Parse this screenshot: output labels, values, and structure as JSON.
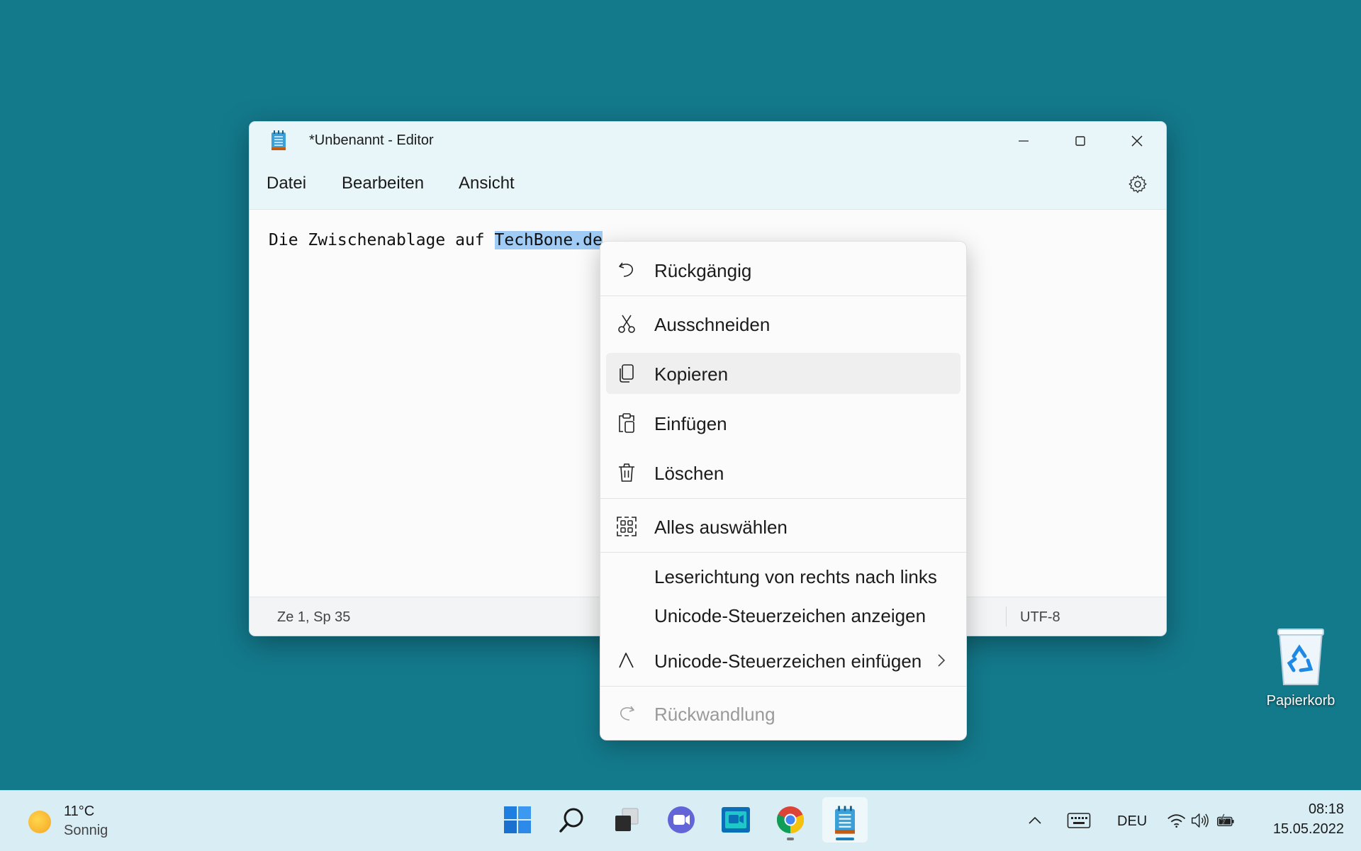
{
  "window": {
    "title": "*Unbenannt - Editor",
    "menu": [
      "Datei",
      "Bearbeiten",
      "Ansicht"
    ],
    "text_before": "Die Zwischenablage auf ",
    "text_selected": "TechBone.de",
    "status": {
      "position": "Ze 1, Sp 35",
      "encoding": "UTF-8"
    }
  },
  "context_menu": {
    "items": [
      {
        "label": "Rückgängig",
        "icon": "undo-icon"
      },
      {
        "label": "Ausschneiden",
        "icon": "scissors-icon"
      },
      {
        "label": "Kopieren",
        "icon": "copy-icon",
        "hovered": true
      },
      {
        "label": "Einfügen",
        "icon": "paste-icon"
      },
      {
        "label": "Löschen",
        "icon": "trash-icon"
      },
      {
        "label": "Alles auswählen",
        "icon": "select-all-icon"
      },
      {
        "label": "Leserichtung von rechts nach links",
        "icon": ""
      },
      {
        "label": "Unicode-Steuerzeichen anzeigen",
        "icon": ""
      },
      {
        "label": "Unicode-Steuerzeichen einfügen",
        "icon": "caret-icon",
        "submenu": true
      },
      {
        "label": "Rückwandlung",
        "icon": "redo-icon",
        "disabled": true
      }
    ]
  },
  "desktop": {
    "recycle_bin_label": "Papierkorb"
  },
  "taskbar": {
    "weather": {
      "temp": "11°C",
      "desc": "Sonnig"
    },
    "apps": [
      "start-icon",
      "search-icon",
      "task-view-icon",
      "teams-chat-icon",
      "media-app-icon",
      "chrome-icon",
      "notepad-icon"
    ],
    "language": "DEU",
    "time": "08:18",
    "date": "15.05.2022"
  },
  "colors": {
    "desktop": "#137a8c",
    "selection": "#9fcbf5",
    "taskbar": "#d9eef4"
  }
}
